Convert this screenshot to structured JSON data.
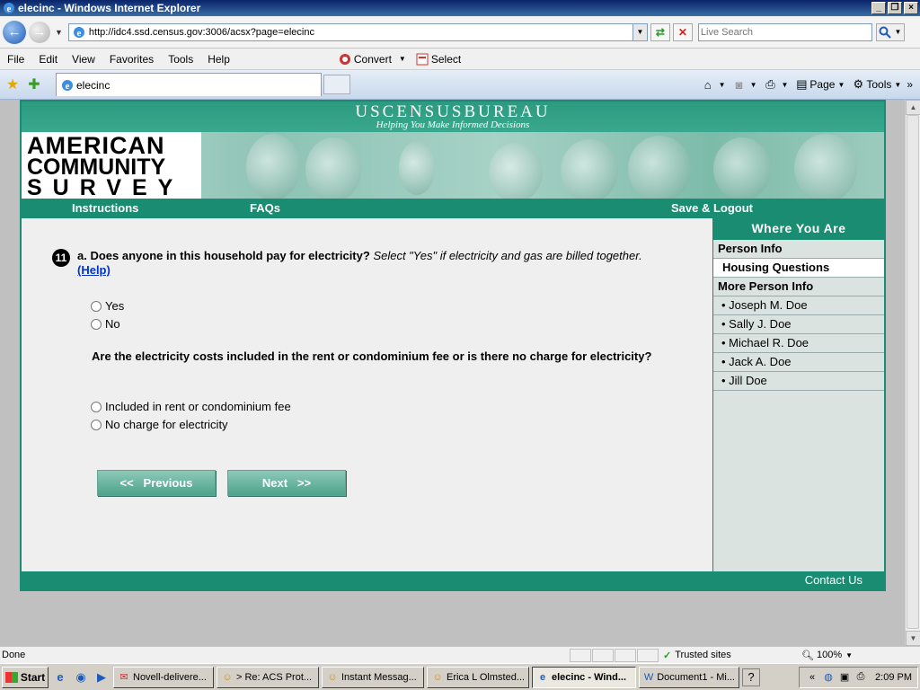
{
  "window": {
    "title": "elecinc - Windows Internet Explorer"
  },
  "address_bar": {
    "url": "http://idc4.ssd.census.gov:3006/acsx?page=elecinc",
    "search_placeholder": "Live Search"
  },
  "menu": {
    "items": [
      "File",
      "Edit",
      "View",
      "Favorites",
      "Tools",
      "Help"
    ],
    "convert": "Convert",
    "select": "Select"
  },
  "tabs": {
    "active_tab": "elecinc"
  },
  "command_bar": {
    "page": "Page",
    "tools": "Tools"
  },
  "site": {
    "banner_title": "USCENSUSBUREAU",
    "banner_tagline": "Helping You Make Informed Decisions",
    "logo": {
      "line1": "AMERICAN",
      "line2": "COMMUNITY",
      "line3": "SURVEY"
    },
    "nav": {
      "instructions": "Instructions",
      "faqs": "FAQs",
      "save_logout": "Save & Logout"
    },
    "footer": {
      "contact": "Contact Us"
    }
  },
  "question": {
    "number": "11",
    "part": "a.",
    "text": "Does anyone in this household pay for electricity?",
    "note": "Select \"Yes\" if electricity and gas are billed together.",
    "help": "(Help)",
    "options1": [
      "Yes",
      "No"
    ],
    "followup": "Are the electricity costs included in the rent or condominium fee or is there no charge for electricity?",
    "options2": [
      "Included in rent or condominium fee",
      "No charge for electricity"
    ]
  },
  "buttons": {
    "previous": "<<   Previous",
    "next": "Next   >>"
  },
  "sidebar": {
    "heading": "Where You Are",
    "person_info": "Person Info",
    "housing": "Housing Questions",
    "more_person_info": "More Person Info",
    "persons": [
      "• Joseph M. Doe",
      "• Sally J. Doe",
      "• Michael R. Doe",
      "• Jack A. Doe",
      "• Jill Doe"
    ]
  },
  "statusbar": {
    "status": "Done",
    "zone": "Trusted sites",
    "zoom": "100%"
  },
  "taskbar": {
    "start": "Start",
    "tasks": [
      "Novell-delivere...",
      "> Re: ACS Prot...",
      "Instant Messag...",
      "Erica L Olmsted...",
      "elecinc - Wind...",
      "Document1 - Mi..."
    ],
    "clock": "2:09 PM"
  },
  "colors": {
    "brand_green": "#1a8c71",
    "link_blue": "#0033cc"
  }
}
